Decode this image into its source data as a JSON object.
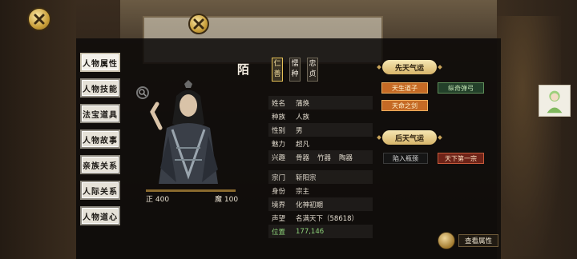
{
  "nav": {
    "items": [
      {
        "label": "人物属性"
      },
      {
        "label": "人物技能"
      },
      {
        "label": "法宝道具"
      },
      {
        "label": "人物故事"
      },
      {
        "label": "亲族关系"
      },
      {
        "label": "人际关系"
      },
      {
        "label": "人物道心"
      }
    ]
  },
  "character": {
    "name": "陌",
    "traits": [
      "仁善",
      "懦种",
      "忠贞"
    ],
    "stat_left": "正 400",
    "stat_right": "魔 100",
    "info": {
      "name_label": "姓名",
      "name_value": "蒲焕",
      "race_label": "种族",
      "race_value": "人族",
      "gender_label": "性别",
      "gender_value": "男",
      "charm_label": "魅力",
      "charm_value": "超凡",
      "hobby_label": "兴趣",
      "hobbies": [
        "骨器",
        "竹器",
        "陶器"
      ],
      "sect_label": "宗门",
      "sect_value": "斩阳宗",
      "identity_label": "身份",
      "identity_value": "宗主",
      "realm_label": "境界",
      "realm_value": "化神初期",
      "fame_label": "声望",
      "fame_value": "名满天下（58618）",
      "pos_label": "位置",
      "pos_value": "177,146"
    }
  },
  "luck": {
    "innate_title": "先天气运",
    "innate_tags": [
      "天生道子",
      "纵奇弹弓",
      "天命之剑"
    ],
    "acquired_title": "后天气运",
    "acquired_tags": [
      "陷入瓶颈",
      "天下第一宗"
    ]
  },
  "buttons": {
    "view_attr": "查看属性"
  },
  "colors": {
    "accent_gold": "#d7b56a",
    "tag_orange": "#c56a25",
    "position_green": "#8ed37a"
  }
}
